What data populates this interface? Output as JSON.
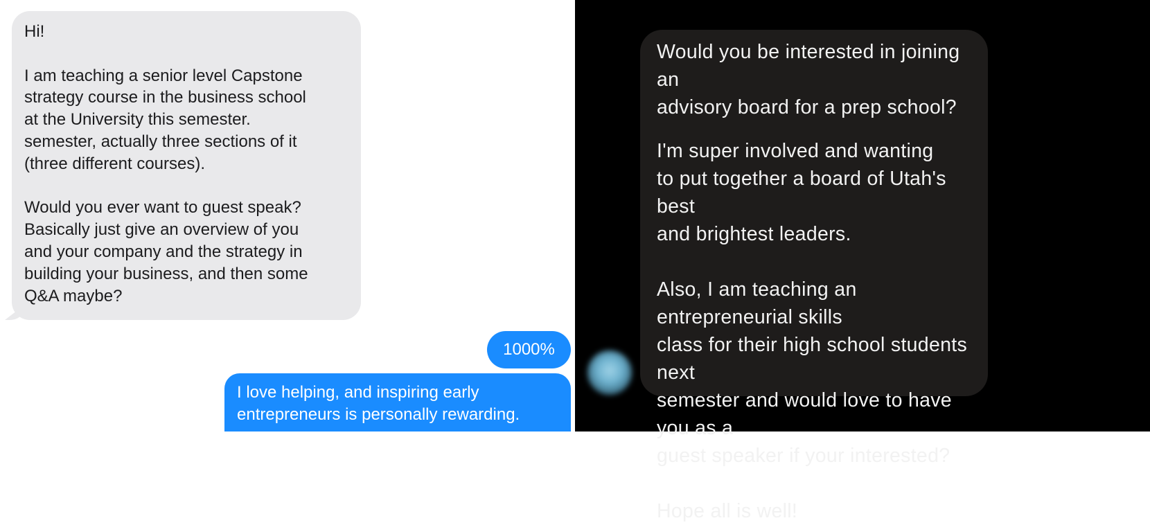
{
  "left_conversation": {
    "received_message": {
      "greeting": "Hi!",
      "paragraph_1": "I am teaching a senior level Capstone\nstrategy course in the business school\nat the University this semester.\nsemester, actually three sections of it\n(three different courses).",
      "paragraph_2": "Would you ever want to guest speak?\nBasically just give an overview of you\nand your company and the strategy in\nbuilding your business, and then some\nQ&A maybe?"
    },
    "sent_messages": [
      {
        "text": "1000%"
      },
      {
        "text": "I love helping, and inspiring early\nentrepreneurs is personally rewarding."
      }
    ],
    "colors": {
      "received_bubble": "#e9e9eb",
      "sent_bubble": "#1a8cff"
    }
  },
  "right_conversation": {
    "received_message": {
      "paragraph_1": "Would you be interested in joining an\nadvisory board for a prep school?",
      "paragraph_2": "I'm super involved and wanting\nto put together a board of Utah's best\nand brightest leaders.",
      "paragraph_3": "Also, I am teaching an entrepreneurial skills\nclass for their high school students next\nsemester and would love to have you as a\nguest speaker if your interested?",
      "paragraph_4": "Hope all is well!"
    },
    "sender_avatar": "blurred-profile-avatar",
    "colors": {
      "background": "#000000",
      "received_bubble": "#1e1c1b"
    }
  }
}
